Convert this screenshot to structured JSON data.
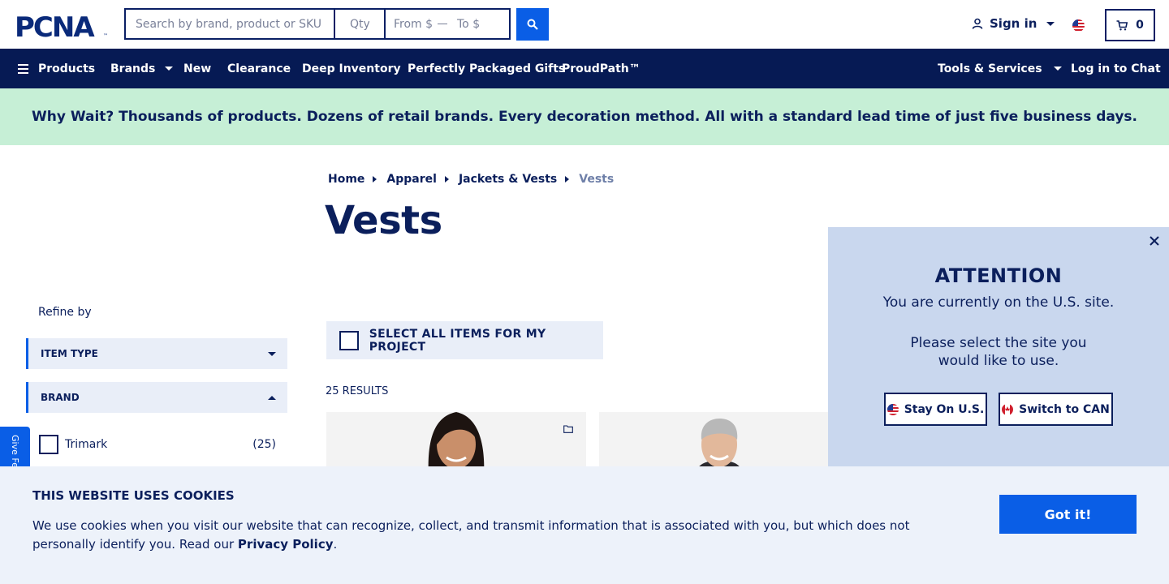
{
  "header": {
    "logo_text": "PCNA",
    "search_placeholder": "Search by brand, product or SKU",
    "qty_placeholder": "Qty",
    "price_from_placeholder": "From $",
    "price_to_placeholder": "To $",
    "signin_label": "Sign in",
    "cart_count": "0"
  },
  "nav": {
    "items": [
      "Products",
      "Brands",
      "New",
      "Clearance",
      "Deep Inventory",
      "Perfectly Packaged Gifts",
      "ProudPath™"
    ],
    "tools_label": "Tools & Services",
    "chat_label": "Log in to Chat"
  },
  "banner": {
    "text": "Why Wait? Thousands of products. Dozens of retail brands. Every decoration method. All with a standard lead time of just five business days."
  },
  "breadcrumb": [
    "Home",
    "Apparel",
    "Jackets & Vests",
    "Vests"
  ],
  "page_title": "Vests",
  "sidebar": {
    "refine_label": "Refine by",
    "facets": [
      "ITEM TYPE",
      "BRAND"
    ],
    "brand_option": {
      "label": "Trimark",
      "count": "(25)"
    },
    "feedback_label": "Give Feedback"
  },
  "results": {
    "select_all_label": "SELECT ALL ITEMS FOR MY PROJECT",
    "count_label": "25 RESULTS"
  },
  "popup": {
    "title": "ATTENTION",
    "line1": "You are currently on the U.S. site.",
    "line2": "Please select the site you would like to use.",
    "stay_label": "Stay On U.S.",
    "switch_label": "Switch to CAN"
  },
  "cookie": {
    "title": "THIS WEBSITE USES COOKIES",
    "text": "We use cookies when you visit our website that can recognize, collect, and transmit information that is associated with you, but which does not personally identify you. Read our",
    "link_label": "Privacy Policy",
    "period": ".",
    "button_label": "Got it!"
  },
  "colors": {
    "navy": "#061a54",
    "text_navy": "#0b1f5c",
    "accent_blue": "#0a5ee6",
    "banner_green": "#c6efd6",
    "popup_bg": "#c9d7ee",
    "cookie_bg": "#edf2fa"
  },
  "icons": [
    "search-icon",
    "user-icon",
    "us-flag-icon",
    "cart-icon",
    "hamburger-icon",
    "close-icon",
    "save-to-project-icon",
    "canada-flag-icon"
  ]
}
